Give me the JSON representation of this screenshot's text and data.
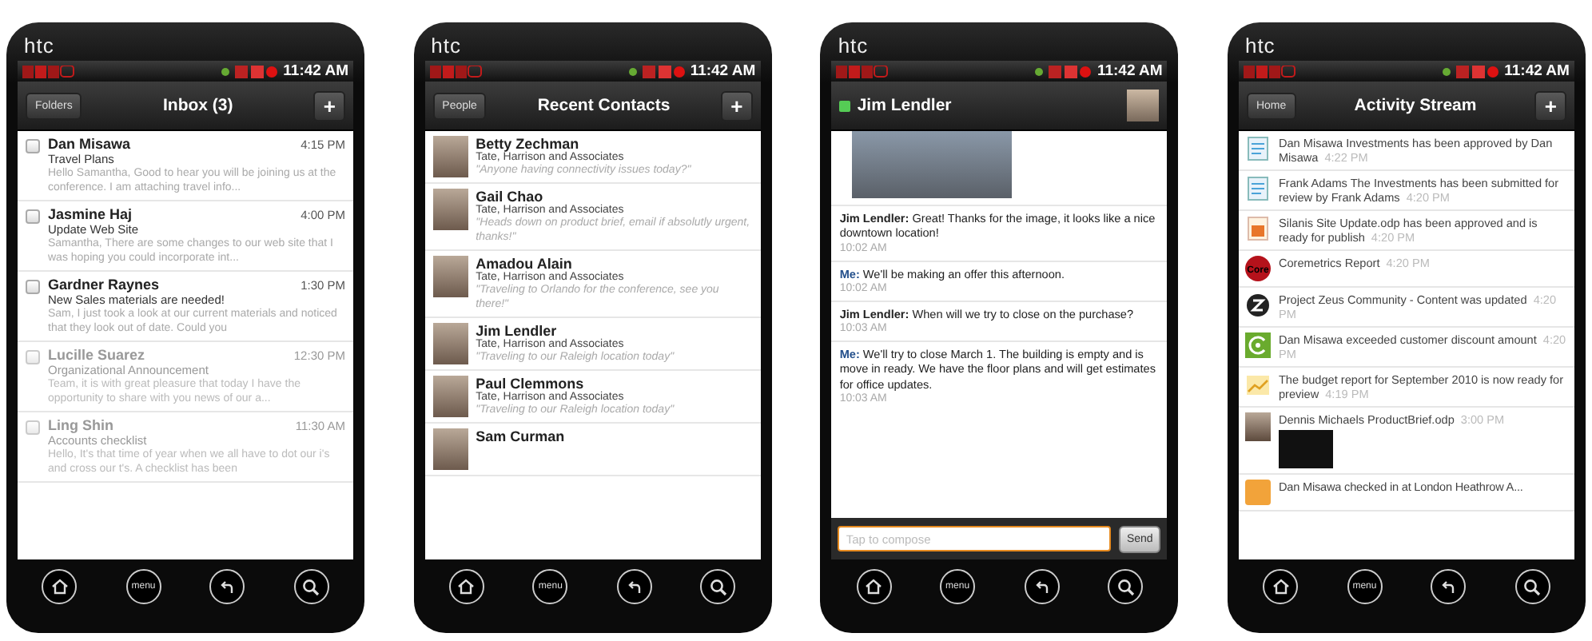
{
  "phones": [
    {
      "kind": "inbox",
      "brand": "htc",
      "status_bar": {
        "time": "11:42 AM"
      },
      "header": {
        "left_button": "Folders",
        "title": "Inbox (3)",
        "right_button": "+"
      },
      "messages": [
        {
          "sender": "Dan Misawa",
          "time": "4:15 PM",
          "subject": "Travel Plans",
          "preview": "Hello Samantha, Good to hear you will be joining us at the conference. I am attaching travel info...",
          "unread": true,
          "checked": false
        },
        {
          "sender": "Jasmine Haj",
          "time": "4:00 PM",
          "subject": "Update Web Site",
          "preview": "Samantha, There are some changes to our web site that I was hoping you could incorporate int...",
          "unread": true,
          "checked": false
        },
        {
          "sender": "Gardner Raynes",
          "time": "1:30 PM",
          "subject": "New Sales materials are needed!",
          "preview": "Sam, I just took a look at our current materials and noticed that they look out of date. Could you",
          "unread": true,
          "checked": false
        },
        {
          "sender": "Lucille Suarez",
          "time": "12:30 PM",
          "subject": "Organizational Announcement",
          "preview": "Team, it is with great pleasure that today I have the opportunity to share with you news of our a...",
          "unread": false,
          "checked": false
        },
        {
          "sender": "Ling Shin",
          "time": "11:30 AM",
          "subject": "Accounts checklist",
          "preview": "Hello, It's that time of year when we all have to dot our i's and cross our t's. A checklist has been",
          "unread": false,
          "checked": false
        }
      ],
      "nav": {
        "menu_label": "menu"
      }
    },
    {
      "kind": "contacts",
      "brand": "htc",
      "status_bar": {
        "time": "11:42 AM"
      },
      "header": {
        "left_button": "People",
        "title": "Recent Contacts",
        "right_button": "+"
      },
      "contacts": [
        {
          "name": "Betty Zechman",
          "company": "Tate, Harrison and Associates",
          "status": "\"Anyone having connectivity issues today?\""
        },
        {
          "name": "Gail Chao",
          "company": "Tate, Harrison and Associates",
          "status": "\"Heads down on product brief, email if absolutly urgent, thanks!\""
        },
        {
          "name": "Amadou Alain",
          "company": "Tate, Harrison and Associates",
          "status": "\"Traveling to Orlando for the conference, see you there!\""
        },
        {
          "name": "Jim Lendler",
          "company": "Tate, Harrison and Associates",
          "status": "\"Traveling to our Raleigh location today\""
        },
        {
          "name": "Paul Clemmons",
          "company": "Tate, Harrison and Associates",
          "status": "\"Traveling to our Raleigh location today\""
        },
        {
          "name": "Sam Curman"
        }
      ],
      "nav": {
        "menu_label": "menu"
      }
    },
    {
      "kind": "chat",
      "brand": "htc",
      "status_bar": {
        "time": "11:42 AM"
      },
      "header": {
        "title": "Jim Lendler",
        "online": true
      },
      "messages": [
        {
          "sender": "Jim Lendler:",
          "from_me": false,
          "text": "Great! Thanks for the image, it looks like a nice downtown location!",
          "time": "10:02 AM"
        },
        {
          "sender": "Me:",
          "from_me": true,
          "text": "We'll be making an offer this afternoon.",
          "time": "10:02 AM"
        },
        {
          "sender": "Jim Lendler:",
          "from_me": false,
          "text": "When will we try to close on the purchase?",
          "time": "10:03 AM"
        },
        {
          "sender": "Me:",
          "from_me": true,
          "text": "We'll try to close March 1. The building is empty and is move in ready. We have the floor plans and will get estimates for office updates.",
          "time": "10:03 AM"
        }
      ],
      "compose": {
        "placeholder": "Tap to compose",
        "send_button": "Send"
      },
      "nav": {
        "menu_label": "menu"
      }
    },
    {
      "kind": "activity",
      "brand": "htc",
      "status_bar": {
        "time": "11:42 AM"
      },
      "header": {
        "left_button": "Home",
        "title": "Activity Stream",
        "right_button": "+"
      },
      "items": [
        {
          "kind": "document",
          "text": "Dan Misawa Investments has been approved by Dan Misawa",
          "time": "4:22 PM"
        },
        {
          "kind": "document",
          "text": "Frank Adams The Investments has been submitted for review by Frank Adams",
          "time": "4:20 PM"
        },
        {
          "kind": "presentation",
          "text": "Silanis Site Update.odp has been approved and is ready for publish",
          "time": "4:20 PM"
        },
        {
          "kind": "logo",
          "logo_text": "Core",
          "text": "Coremetrics Report",
          "time": "4:20 PM"
        },
        {
          "kind": "community",
          "text": "Project Zeus Community - Content was updated",
          "time": "4:20 PM"
        },
        {
          "kind": "gauge",
          "text": "Dan Misawa exceeded customer discount amount",
          "time": "4:20 PM"
        },
        {
          "kind": "chart",
          "text": "The budget report for September 2010 is now ready for preview",
          "time": "4:19 PM"
        },
        {
          "kind": "person",
          "text": "Dennis Michaels ProductBrief.odp",
          "time": "3:00 PM",
          "thumbnail": true
        },
        {
          "kind": "checkin",
          "text": "Dan Misawa checked in at London Heathrow A..."
        }
      ],
      "nav": {
        "menu_label": "menu"
      }
    }
  ]
}
